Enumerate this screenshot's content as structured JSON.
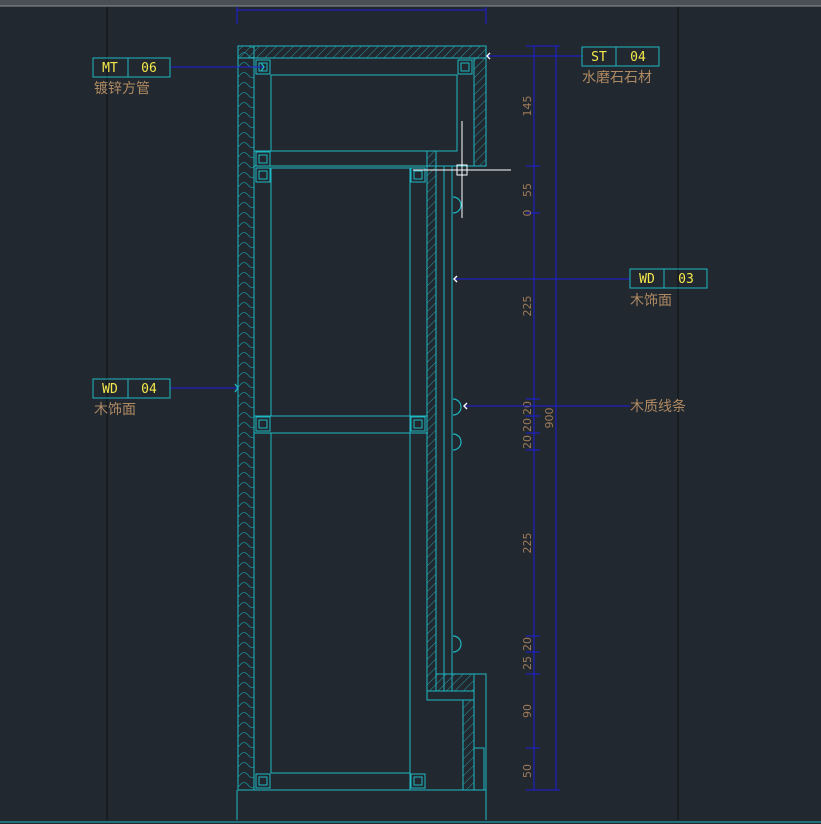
{
  "tags": {
    "mt06": {
      "code": "MT",
      "num": "06",
      "note": "镀锌方管"
    },
    "st04": {
      "code": "ST",
      "num": "04",
      "note": "水磨石石材"
    },
    "wd03": {
      "code": "WD",
      "num": "03",
      "note": "木饰面"
    },
    "wd04": {
      "code": "WD",
      "num": "04",
      "note": "木饰面"
    }
  },
  "notes": {
    "wood_trim": "木质线条"
  },
  "dimensions": {
    "d145": "145",
    "d55": "55",
    "d0": "0",
    "d225a": "225",
    "d20a": "20",
    "d20b": "20",
    "d20c": "20",
    "d900": "900",
    "d225b": "225",
    "d20d": "20",
    "d25": "25",
    "d90": "90",
    "d50": "50"
  },
  "colors": {
    "background": "#212830",
    "drawing_cyan": "#1fb8c2",
    "leader_blue": "#1e1edc",
    "tag_yellow": "#f5e84a",
    "note_brown": "#b08a62",
    "dim_brown": "#a07a58"
  }
}
